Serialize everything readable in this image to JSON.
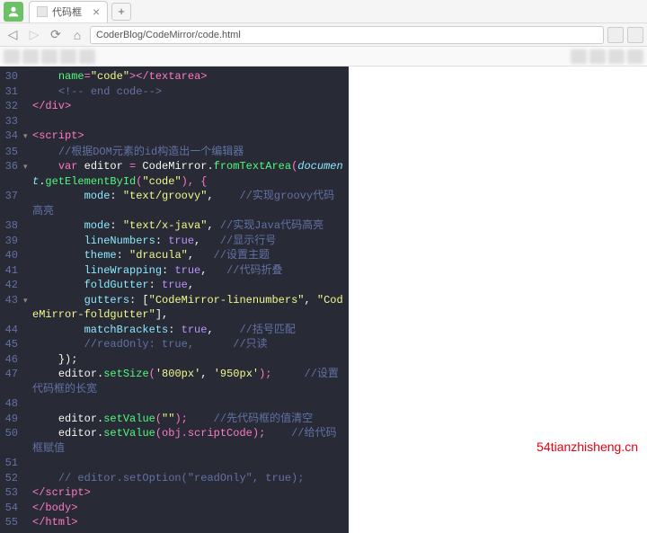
{
  "tab": {
    "title": "代码框",
    "close": "×",
    "new": "+"
  },
  "url": {
    "blur": "                        ",
    "path": "CoderBlog/CodeMirror/code.html"
  },
  "lines": [
    {
      "n": "30",
      "f": "",
      "seg": [
        [
          "    ",
          ""
        ],
        [
          "name",
          "c-attr"
        ],
        [
          "=",
          "c-brk"
        ],
        [
          "\"code\"",
          "c-str"
        ],
        [
          ">",
          "c-brk"
        ],
        [
          "</",
          "c-brk"
        ],
        [
          "textarea",
          "c-tag"
        ],
        [
          ">",
          "c-brk"
        ]
      ]
    },
    {
      "n": "31",
      "f": "",
      "seg": [
        [
          "    ",
          ""
        ],
        [
          "<!-- end code-->",
          "c-cmt"
        ]
      ]
    },
    {
      "n": "32",
      "f": "",
      "seg": [
        [
          "</",
          "c-brk"
        ],
        [
          "div",
          "c-tag"
        ],
        [
          ">",
          "c-brk"
        ]
      ]
    },
    {
      "n": "33",
      "f": "",
      "seg": []
    },
    {
      "n": "34",
      "f": "▾",
      "seg": [
        [
          "<",
          "c-brk"
        ],
        [
          "script",
          "c-tag"
        ],
        [
          ">",
          "c-brk"
        ]
      ]
    },
    {
      "n": "35",
      "f": "",
      "seg": [
        [
          "    ",
          ""
        ],
        [
          "//根据DOM元素的id构造出一个编辑器",
          "c-cmt"
        ]
      ]
    },
    {
      "n": "36",
      "f": "▾",
      "seg": [
        [
          "    ",
          ""
        ],
        [
          "var",
          "c-kw"
        ],
        [
          " editor ",
          "c-var"
        ],
        [
          "=",
          "c-brk"
        ],
        [
          " CodeMirror.",
          "c-var"
        ],
        [
          "fromTextArea",
          "c-fn"
        ],
        [
          "(",
          "c-brk"
        ],
        [
          "document",
          "c-def"
        ],
        [
          ".",
          "c-var"
        ],
        [
          "getElementById",
          "c-fn"
        ],
        [
          "(",
          "c-brk"
        ],
        [
          "\"code\"",
          "c-str"
        ],
        [
          "), {",
          "c-brk"
        ]
      ]
    },
    {
      "n": "37",
      "f": "",
      "seg": [
        [
          "        ",
          ""
        ],
        [
          "mode",
          "c-prop"
        ],
        [
          ": ",
          ""
        ],
        [
          "\"text/groovy\"",
          "c-str"
        ],
        [
          ",    ",
          ""
        ],
        [
          "//实现groovy代码高亮",
          "c-cmt"
        ]
      ]
    },
    {
      "n": "38",
      "f": "",
      "seg": [
        [
          "        ",
          ""
        ],
        [
          "mode",
          "c-prop"
        ],
        [
          ": ",
          ""
        ],
        [
          "\"text/x-java\"",
          "c-str"
        ],
        [
          ", ",
          ""
        ],
        [
          "//实现Java代码高亮",
          "c-cmt"
        ]
      ]
    },
    {
      "n": "39",
      "f": "",
      "seg": [
        [
          "        ",
          ""
        ],
        [
          "lineNumbers",
          "c-prop"
        ],
        [
          ": ",
          ""
        ],
        [
          "true",
          "c-bool"
        ],
        [
          ",   ",
          ""
        ],
        [
          "//显示行号",
          "c-cmt"
        ]
      ]
    },
    {
      "n": "40",
      "f": "",
      "seg": [
        [
          "        ",
          ""
        ],
        [
          "theme",
          "c-prop"
        ],
        [
          ": ",
          ""
        ],
        [
          "\"dracula\"",
          "c-str"
        ],
        [
          ",   ",
          ""
        ],
        [
          "//设置主题",
          "c-cmt"
        ]
      ]
    },
    {
      "n": "41",
      "f": "",
      "seg": [
        [
          "        ",
          ""
        ],
        [
          "lineWrapping",
          "c-prop"
        ],
        [
          ": ",
          ""
        ],
        [
          "true",
          "c-bool"
        ],
        [
          ",   ",
          ""
        ],
        [
          "//代码折叠",
          "c-cmt"
        ]
      ]
    },
    {
      "n": "42",
      "f": "",
      "seg": [
        [
          "        ",
          ""
        ],
        [
          "foldGutter",
          "c-prop"
        ],
        [
          ": ",
          ""
        ],
        [
          "true",
          "c-bool"
        ],
        [
          ",",
          ""
        ]
      ]
    },
    {
      "n": "43",
      "f": "▾",
      "seg": [
        [
          "        ",
          ""
        ],
        [
          "gutters",
          "c-prop"
        ],
        [
          ": [",
          ""
        ],
        [
          "\"CodeMirror-linenumbers\"",
          "c-str"
        ],
        [
          ", ",
          ""
        ],
        [
          "\"CodeMirror-foldgutter\"",
          "c-str"
        ],
        [
          "],",
          ""
        ]
      ]
    },
    {
      "n": "44",
      "f": "",
      "seg": [
        [
          "        ",
          ""
        ],
        [
          "matchBrackets",
          "c-prop"
        ],
        [
          ": ",
          ""
        ],
        [
          "true",
          "c-bool"
        ],
        [
          ",    ",
          ""
        ],
        [
          "//括号匹配",
          "c-cmt"
        ]
      ]
    },
    {
      "n": "45",
      "f": "",
      "seg": [
        [
          "        ",
          ""
        ],
        [
          "//readOnly: true,      //只读",
          "c-cmt"
        ]
      ]
    },
    {
      "n": "46",
      "f": "",
      "seg": [
        [
          "    });",
          ""
        ]
      ]
    },
    {
      "n": "47",
      "f": "",
      "seg": [
        [
          "    editor.",
          "c-var"
        ],
        [
          "setSize",
          "c-fn"
        ],
        [
          "(",
          "c-brk"
        ],
        [
          "'800px'",
          "c-str"
        ],
        [
          ", ",
          ""
        ],
        [
          "'950px'",
          "c-str"
        ],
        [
          ");     ",
          "c-brk"
        ],
        [
          "//设置代码框的长宽",
          "c-cmt"
        ]
      ]
    },
    {
      "n": "48",
      "f": "",
      "seg": []
    },
    {
      "n": "49",
      "f": "",
      "seg": [
        [
          "    editor.",
          "c-var"
        ],
        [
          "setValue",
          "c-fn"
        ],
        [
          "(",
          "c-brk"
        ],
        [
          "\"\"",
          "c-str"
        ],
        [
          ");    ",
          "c-brk"
        ],
        [
          "//先代码框的值清空",
          "c-cmt"
        ]
      ]
    },
    {
      "n": "50",
      "f": "",
      "seg": [
        [
          "    editor.",
          "c-var"
        ],
        [
          "setValue",
          "c-fn"
        ],
        [
          "(obj.scriptCode);    ",
          "c-brk"
        ],
        [
          "//给代码框赋值",
          "c-cmt"
        ]
      ]
    },
    {
      "n": "51",
      "f": "",
      "seg": []
    },
    {
      "n": "52",
      "f": "",
      "seg": [
        [
          "    ",
          ""
        ],
        [
          "// editor.setOption(\"readOnly\", true);",
          "c-cmt"
        ]
      ]
    },
    {
      "n": "53",
      "f": "",
      "seg": [
        [
          "</",
          "c-brk"
        ],
        [
          "script",
          "c-tag"
        ],
        [
          ">",
          "c-brk"
        ]
      ]
    },
    {
      "n": "54",
      "f": "",
      "seg": [
        [
          "</",
          "c-brk"
        ],
        [
          "body",
          "c-tag"
        ],
        [
          ">",
          "c-brk"
        ]
      ]
    },
    {
      "n": "55",
      "f": "",
      "seg": [
        [
          "</",
          "c-brk"
        ],
        [
          "html",
          "c-tag"
        ],
        [
          ">",
          "c-brk"
        ]
      ]
    }
  ],
  "watermark": "54tianzhisheng.cn"
}
